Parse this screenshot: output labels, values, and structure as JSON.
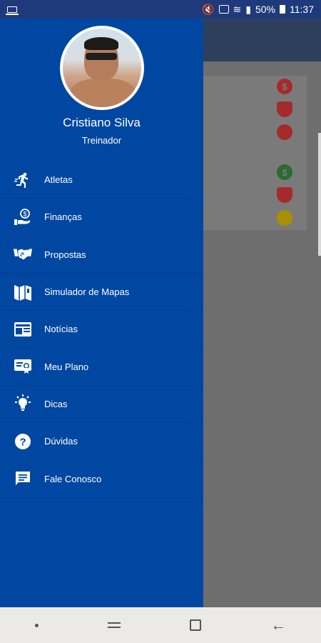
{
  "status_bar": {
    "battery": "50%",
    "time": "11:37"
  },
  "profile": {
    "name": "Cristiano Silva",
    "role": "Treinador"
  },
  "menu": {
    "items": [
      {
        "label": "Atletas",
        "icon": "running-athlete-icon"
      },
      {
        "label": "Finanças",
        "icon": "money-hand-icon"
      },
      {
        "label": "Propostas",
        "icon": "handshake-icon"
      },
      {
        "label": "Simulador de Mapas",
        "icon": "map-icon"
      },
      {
        "label": "Notícias",
        "icon": "newspaper-icon"
      },
      {
        "label": "Meu Plano",
        "icon": "certificate-icon"
      },
      {
        "label": "Dicas",
        "icon": "lightbulb-icon"
      },
      {
        "label": "Dúvidas",
        "icon": "question-icon"
      },
      {
        "label": "Fale Conosco",
        "icon": "chat-icon"
      }
    ]
  },
  "background": {
    "icons": [
      {
        "name": "dollar-icon",
        "color": "#c62828"
      },
      {
        "name": "trophy-icon",
        "color": "#c62828"
      },
      {
        "name": "clock-icon",
        "color": "#c62828"
      },
      {
        "name": "dollar-icon",
        "color": "#2e7d32"
      },
      {
        "name": "trophy-icon",
        "color": "#c62828"
      },
      {
        "name": "clock-icon",
        "color": "#c9a400"
      }
    ]
  },
  "colors": {
    "drawer": "#0047a1",
    "status_bar": "#1f3a7a"
  }
}
